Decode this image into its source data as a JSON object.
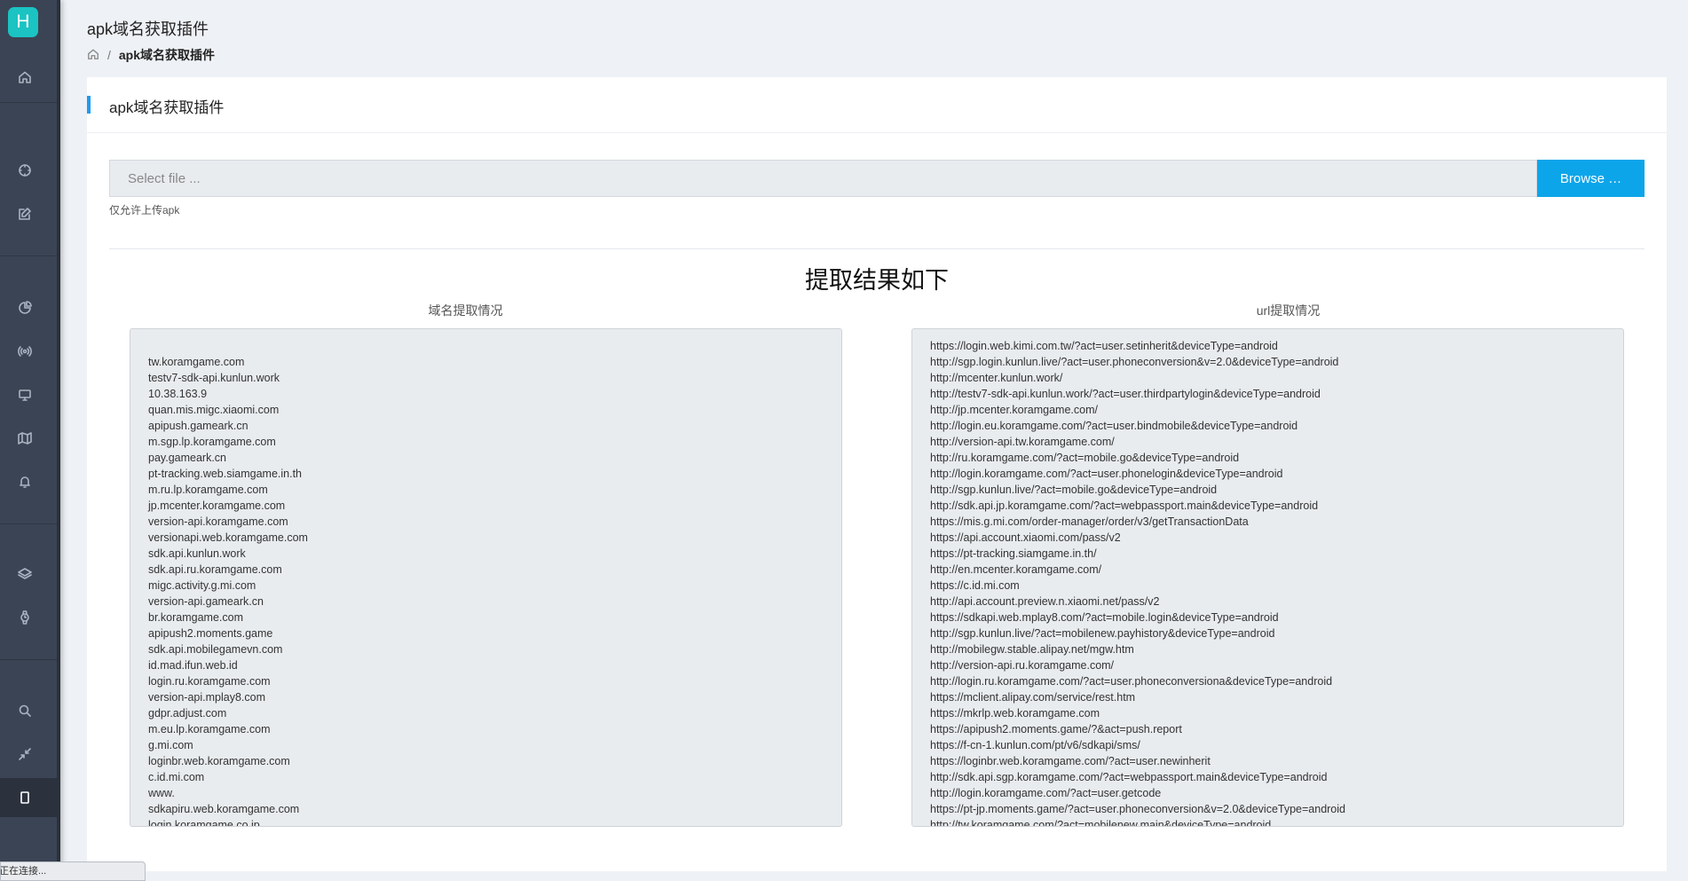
{
  "sidebar": {
    "logo_letter": "H",
    "icons": [
      "home-icon",
      "compass-icon",
      "edit-icon",
      "pie-chart-icon",
      "broadcast-icon",
      "monitor-icon",
      "map-icon",
      "bell-icon",
      "layers-icon",
      "watch-icon",
      "search-icon",
      "collapse-icon",
      "tablet-icon"
    ]
  },
  "status_popup": "正在连接...",
  "header": {
    "title": "apk域名获取插件",
    "breadcrumb_current": "apk域名获取插件",
    "breadcrumb_sep": "/"
  },
  "card": {
    "title": "apk域名获取插件",
    "file_placeholder": "Select file ...",
    "browse_label": "Browse …",
    "hint": "仅允许上传apk",
    "result_title": "提取结果如下",
    "domain_title": "域名提取情况",
    "url_title": "url提取情况",
    "accent_color": "#0da5ea"
  },
  "domains": [
    "",
    "tw.koramgame.com",
    "testv7-sdk-api.kunlun.work",
    "10.38.163.9",
    "quan.mis.migc.xiaomi.com",
    "apipush.gameark.cn",
    "m.sgp.lp.koramgame.com",
    "pay.gameark.cn",
    "pt-tracking.web.siamgame.in.th",
    "m.ru.lp.koramgame.com",
    "jp.mcenter.koramgame.com",
    "version-api.koramgame.com",
    "versionapi.web.koramgame.com",
    "sdk.api.kunlun.work",
    "sdk.api.ru.koramgame.com",
    "migc.activity.g.mi.com",
    "version-api.gameark.cn",
    "br.koramgame.com",
    "apipush2.moments.game",
    "sdk.api.mobilegamevn.com",
    "id.mad.ifun.web.id",
    "login.ru.koramgame.com",
    "version-api.mplay8.com",
    "gdpr.adjust.com",
    "m.eu.lp.koramgame.com",
    "g.mi.com",
    "loginbr.web.koramgame.com",
    "c.id.mi.com",
    "www.",
    "sdkapiru.web.koramgame.com",
    "login.koramgame.co.jp"
  ],
  "urls": [
    "https://login.web.kimi.com.tw/?act=user.setinherit&deviceType=android",
    "http://sgp.login.kunlun.live/?act=user.phoneconversion&v=2.0&deviceType=android",
    "http://mcenter.kunlun.work/",
    "http://testv7-sdk-api.kunlun.work/?act=user.thirdpartylogin&deviceType=android",
    "http://jp.mcenter.koramgame.com/",
    "http://login.eu.koramgame.com/?act=user.bindmobile&deviceType=android",
    "http://version-api.tw.koramgame.com/",
    "http://ru.koramgame.com/?act=mobile.go&deviceType=android",
    "http://login.koramgame.com/?act=user.phonelogin&deviceType=android",
    "http://sgp.kunlun.live/?act=mobile.go&deviceType=android",
    "http://sdk.api.jp.koramgame.com/?act=webpassport.main&deviceType=android",
    "https://mis.g.mi.com/order-manager/order/v3/getTransactionData",
    "https://api.account.xiaomi.com/pass/v2",
    "https://pt-tracking.siamgame.in.th/",
    "http://en.mcenter.koramgame.com/",
    "https://c.id.mi.com",
    "http://api.account.preview.n.xiaomi.net/pass/v2",
    "https://sdkapi.web.mplay8.com/?act=mobile.login&deviceType=android",
    "http://sgp.kunlun.live/?act=mobilenew.payhistory&deviceType=android",
    "http://mobilegw.stable.alipay.net/mgw.htm",
    "http://version-api.ru.koramgame.com/",
    "http://login.ru.koramgame.com/?act=user.phoneconversiona&deviceType=android",
    "https://mclient.alipay.com/service/rest.htm",
    "https://mkrlp.web.koramgame.com",
    "https://apipush2.moments.game/?&act=push.report",
    "https://f-cn-1.kunlun.com/pt/v6/sdkapi/sms/",
    "https://loginbr.web.koramgame.com/?act=user.newinherit",
    "http://sdk.api.sgp.koramgame.com/?act=webpassport.main&deviceType=android",
    "http://login.koramgame.com/?act=user.getcode",
    "https://pt-jp.moments.game/?act=user.phoneconversion&v=2.0&deviceType=android",
    "http://tw.koramgame.com/?act=mobilenew.main&deviceType=android"
  ]
}
